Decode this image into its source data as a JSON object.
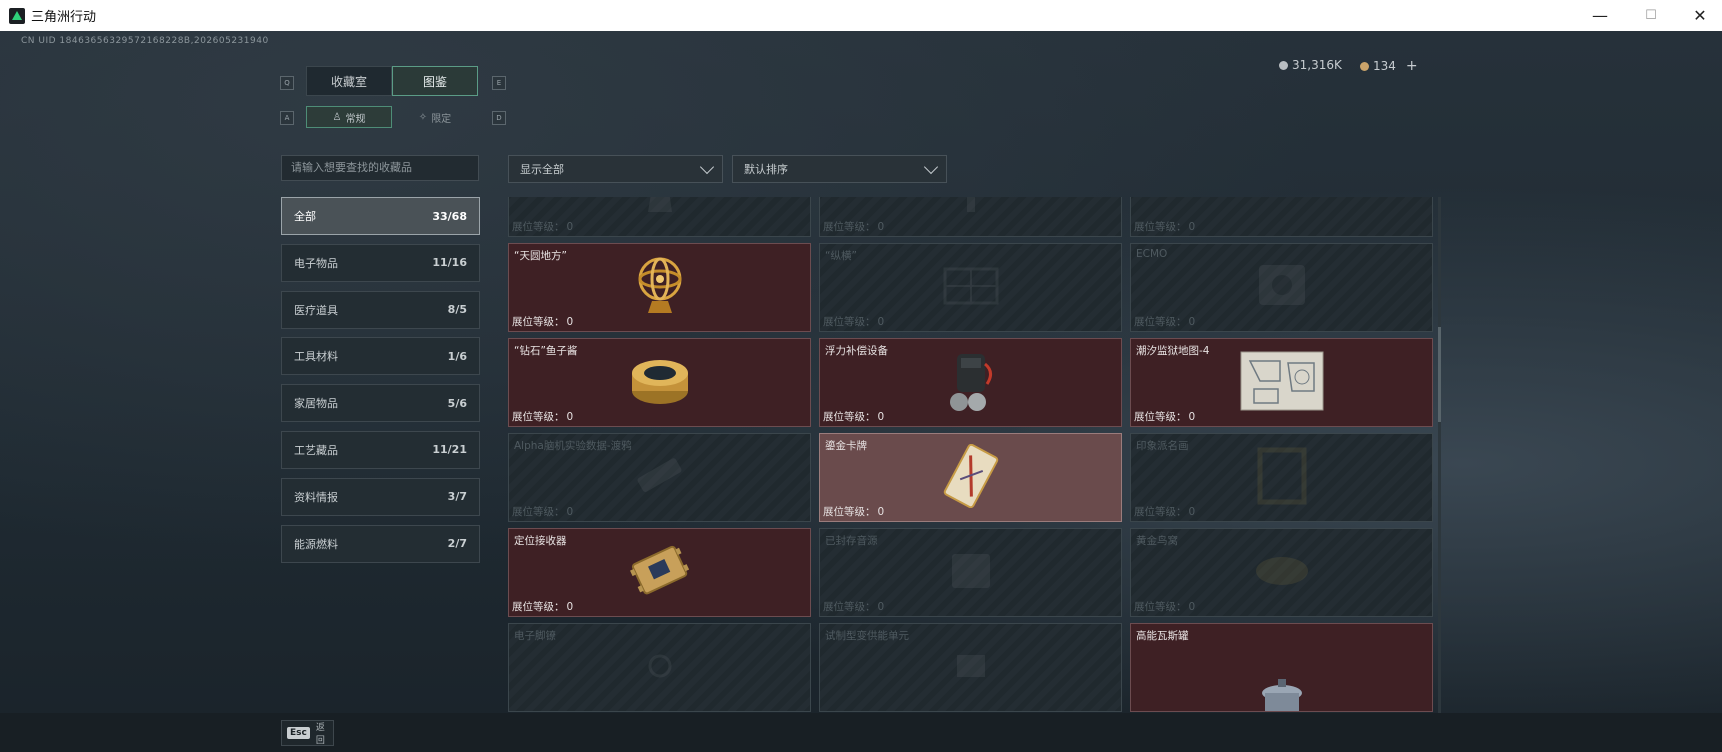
{
  "window": {
    "title": "三角洲行动",
    "minimize": "—",
    "maximize": "☐",
    "close": "✕"
  },
  "uid": "CN UID 18463656329572168228B,202605231940",
  "currency": {
    "silver": "31,316K",
    "gold": "134",
    "add": "+"
  },
  "tabs": [
    {
      "label": "收藏室",
      "key": "Q"
    },
    {
      "label": "图鉴",
      "key": "E"
    }
  ],
  "subtabs": [
    {
      "label": "常规",
      "key": "A"
    },
    {
      "label": "限定",
      "key": "D"
    }
  ],
  "search": {
    "placeholder": "请输入想要查找的收藏品"
  },
  "filters": {
    "display": "显示全部",
    "sort": "默认排序"
  },
  "categories": [
    {
      "label": "全部",
      "count": "33/68"
    },
    {
      "label": "电子物品",
      "count": "11/16"
    },
    {
      "label": "医疗道具",
      "count": "8/5"
    },
    {
      "label": "工具材料",
      "count": "1/6"
    },
    {
      "label": "家居物品",
      "count": "5/6"
    },
    {
      "label": "工艺藏品",
      "count": "11/21"
    },
    {
      "label": "资料情报",
      "count": "3/7"
    },
    {
      "label": "能源燃料",
      "count": "2/7"
    }
  ],
  "level_label": "展位等级：",
  "items": [
    {
      "name": "",
      "level": "0",
      "state": "unowned",
      "icon": "sculpture-icon"
    },
    {
      "name": "",
      "level": "0",
      "state": "unowned",
      "icon": "globe-icon"
    },
    {
      "name": "",
      "level": "0",
      "state": "unowned",
      "icon": "cake-icon"
    },
    {
      "name": "“天圆地方”",
      "level": "0",
      "state": "owned",
      "icon": "armillary-sphere-icon"
    },
    {
      "name": "“纵横”",
      "level": "0",
      "state": "unowned",
      "icon": "chessboard-icon"
    },
    {
      "name": "ECMO",
      "level": "0",
      "state": "unowned",
      "icon": "ecmo-machine-icon"
    },
    {
      "name": "“钻石”鱼子酱",
      "level": "0",
      "state": "owned",
      "icon": "caviar-tin-icon"
    },
    {
      "name": "浮力补偿设备",
      "level": "0",
      "state": "owned",
      "icon": "diving-gear-icon"
    },
    {
      "name": "潮汐监狱地图-4",
      "level": "0",
      "state": "owned",
      "icon": "map-icon"
    },
    {
      "name": "Alpha脑机实验数据-渡鸦",
      "level": "0",
      "state": "unowned",
      "icon": "drive-icon"
    },
    {
      "name": "鎏金卡牌",
      "level": "0",
      "state": "highlight",
      "icon": "gilded-card-icon"
    },
    {
      "name": "印象派名画",
      "level": "0",
      "state": "unowned",
      "icon": "painting-icon"
    },
    {
      "name": "定位接收器",
      "level": "0",
      "state": "owned",
      "icon": "receiver-icon"
    },
    {
      "name": "已封存音源",
      "level": "0",
      "state": "unowned",
      "icon": "audio-device-icon"
    },
    {
      "name": "黄金鸟窝",
      "level": "0",
      "state": "unowned",
      "icon": "golden-nest-icon"
    },
    {
      "name": "电子脚镣",
      "level": "",
      "state": "unowned",
      "icon": "anklet-icon"
    },
    {
      "name": "试制型变供能单元",
      "level": "",
      "state": "unowned",
      "icon": "power-unit-icon"
    },
    {
      "name": "高能瓦斯罐",
      "level": "",
      "state": "owned",
      "icon": "gas-canister-icon"
    }
  ],
  "footer": {
    "esc_key": "Esc",
    "esc_label": "返回"
  }
}
